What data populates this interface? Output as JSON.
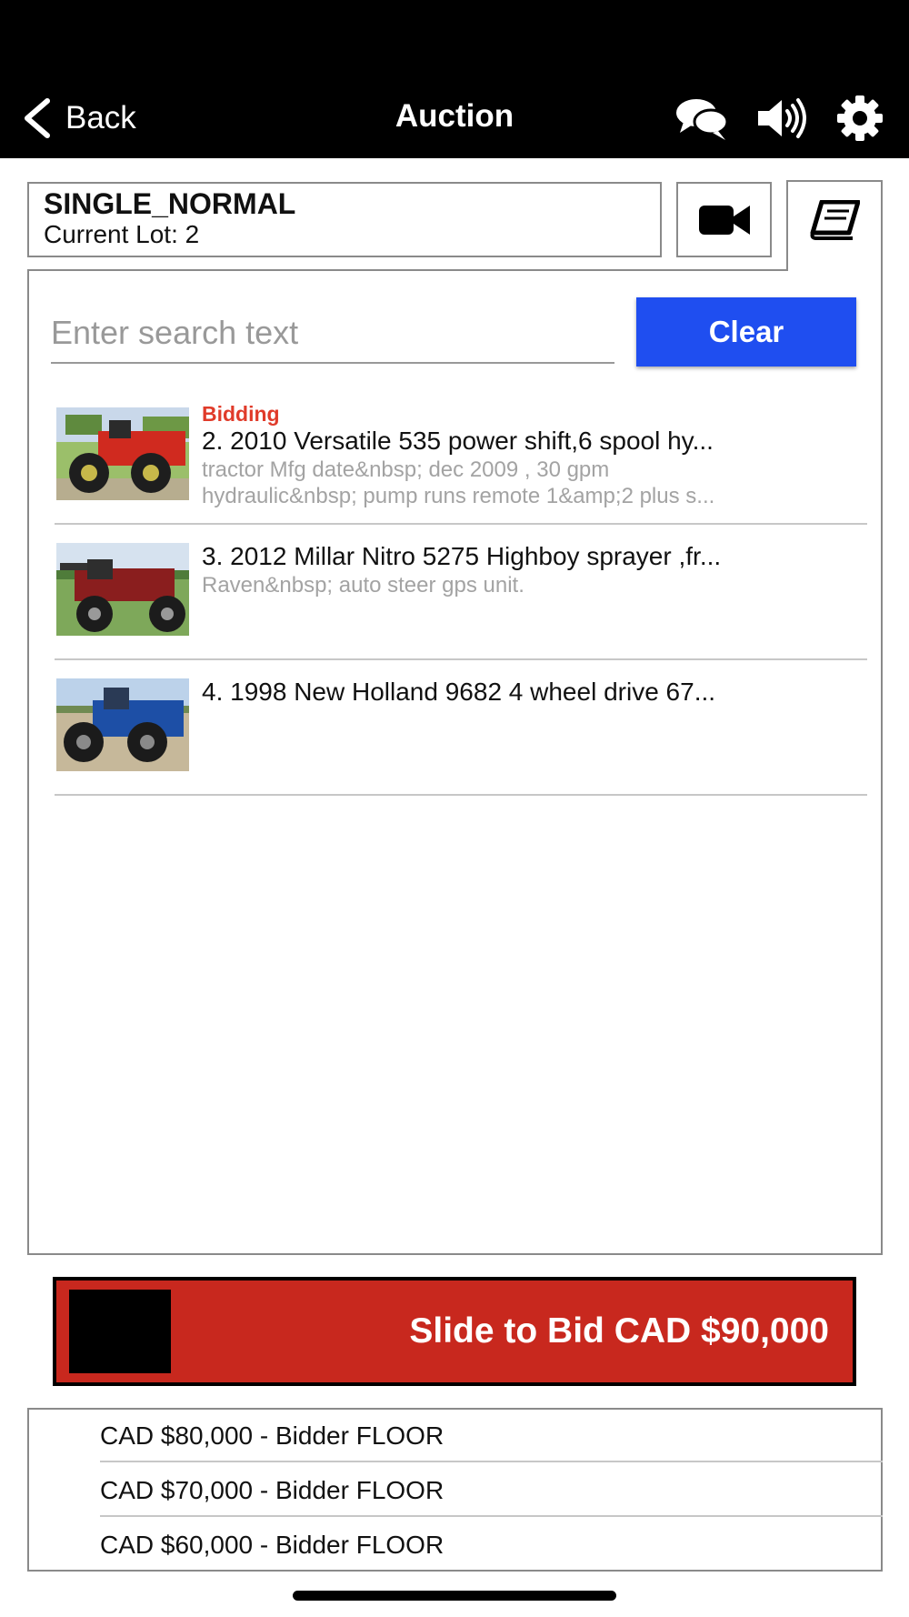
{
  "topbar": {
    "back_label": "Back",
    "title": "Auction",
    "icons": [
      "chevron-left-icon",
      "chat-icon",
      "sound-icon",
      "gear-icon"
    ]
  },
  "sale": {
    "name": "SINGLE_NORMAL",
    "current_lot": "Current Lot: 2"
  },
  "tabs": {
    "video_icon": "video-camera-icon",
    "catalog_icon": "book-icon"
  },
  "search": {
    "placeholder": "Enter search text",
    "value": "",
    "clear_label": "Clear"
  },
  "lots": [
    {
      "status": "Bidding",
      "title": "2. 2010 Versatile 535 power shift,6 spool hy...",
      "desc_line1": "tractor Mfg date&nbsp; dec 2009 , 30 gpm",
      "desc_line2": "hydraulic&nbsp; pump runs remote 1&amp;2 plus s..."
    },
    {
      "status": "",
      "title": "3. 2012 Millar Nitro 5275 Highboy sprayer ,fr...",
      "desc_line1": "Raven&nbsp; auto steer gps unit.",
      "desc_line2": ""
    },
    {
      "status": "",
      "title": "4. 1998 New Holland 9682 4 wheel drive 67...",
      "desc_line1": "",
      "desc_line2": ""
    }
  ],
  "bid": {
    "slide_label": "Slide to Bid CAD $90,000"
  },
  "history": [
    "CAD $80,000 - Bidder FLOOR",
    "CAD $70,000 - Bidder FLOOR",
    "CAD $60,000 - Bidder FLOOR"
  ],
  "colors": {
    "topbar": "#000000",
    "accent_blue": "#1f4ef0",
    "bid_red": "#c8281e",
    "status_red": "#e03b2a"
  }
}
